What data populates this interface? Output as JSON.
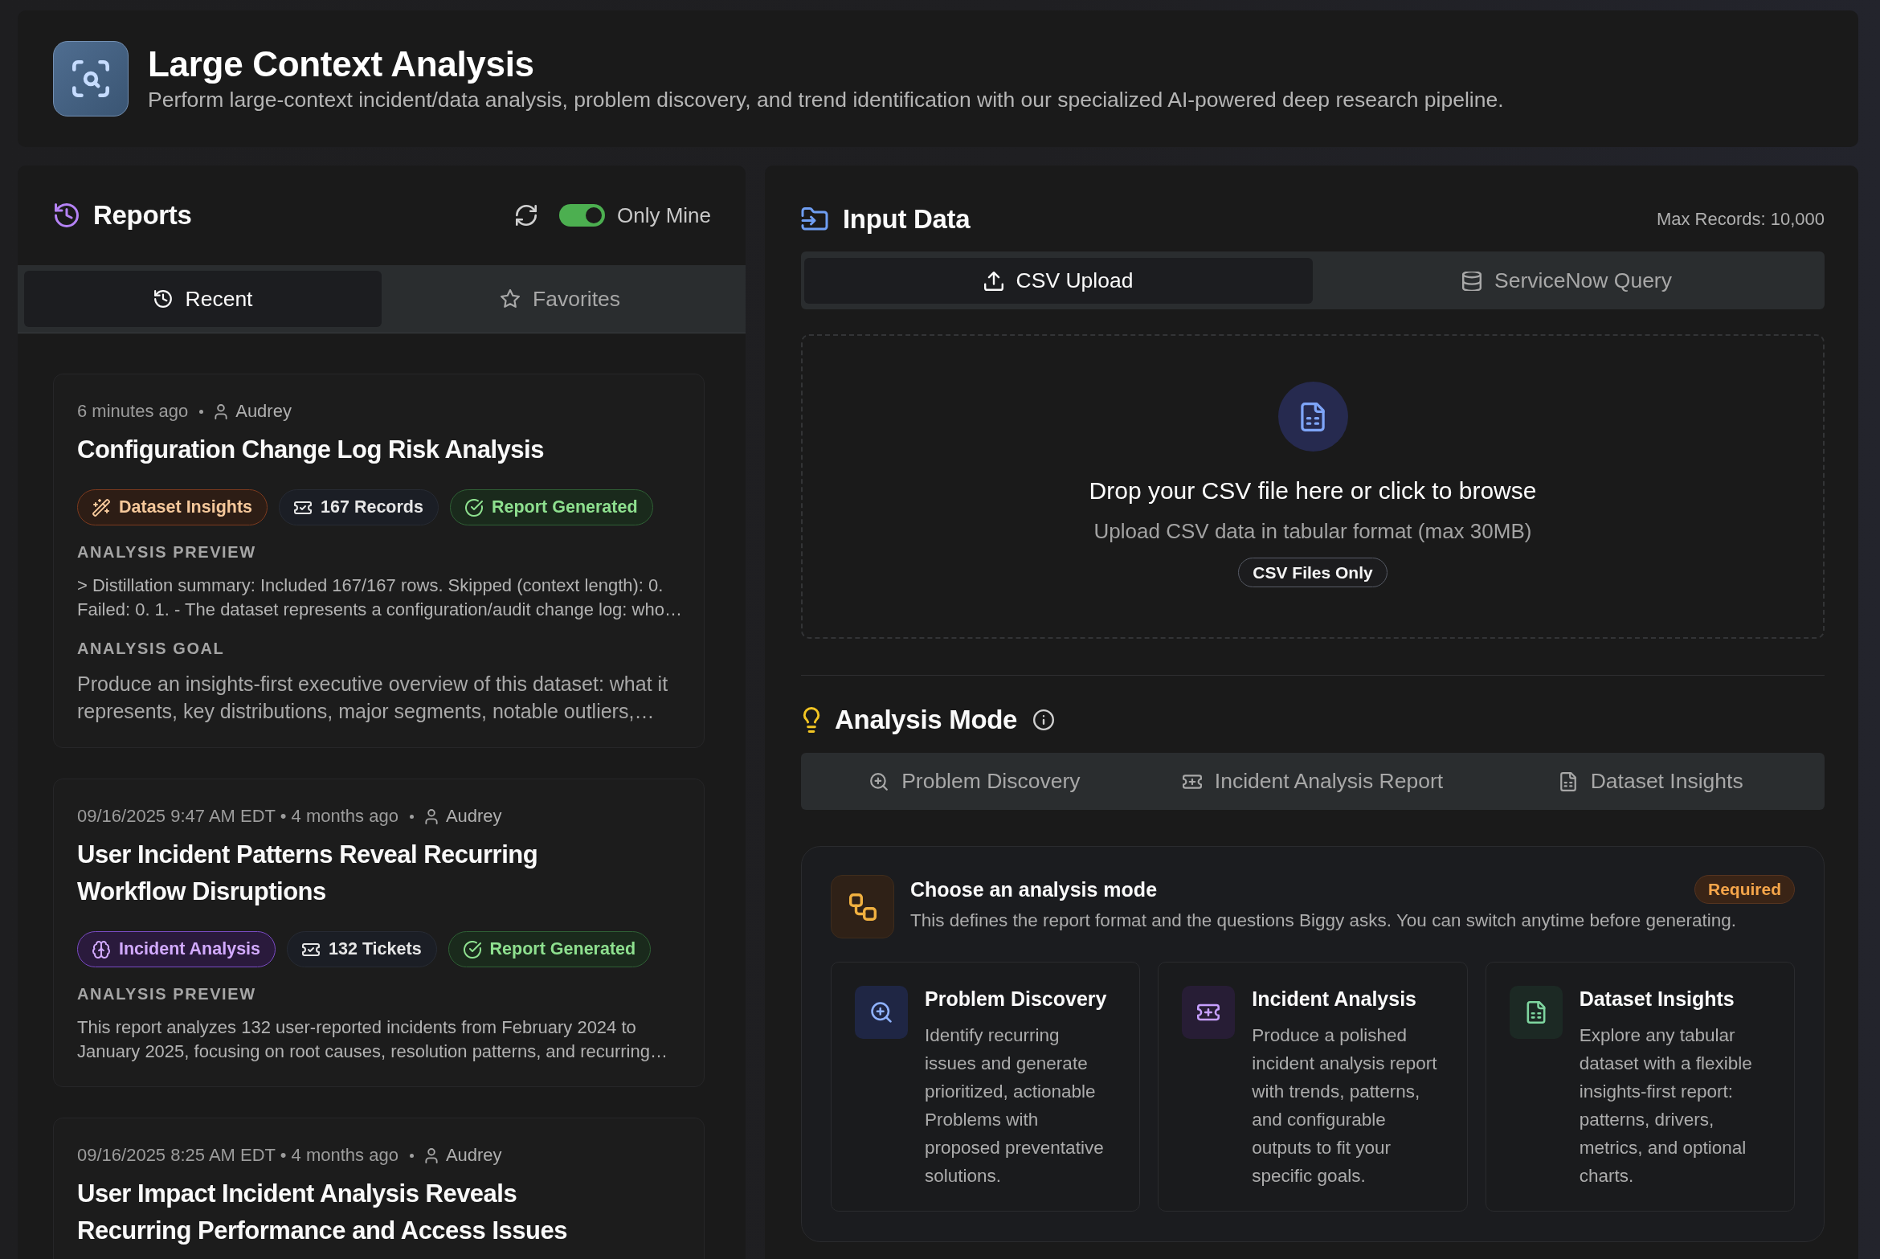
{
  "header": {
    "title": "Large Context Analysis",
    "subtitle": "Perform large-context incident/data analysis, problem discovery, and trend identification with our specialized AI-powered deep research pipeline."
  },
  "reports": {
    "title": "Reports",
    "only_mine": {
      "label": "Only Mine",
      "on": true
    },
    "tabs": [
      {
        "label": "Recent",
        "selected": true
      },
      {
        "label": "Favorites",
        "selected": false
      }
    ],
    "cards": [
      {
        "time": "6 minutes ago",
        "author": "Audrey",
        "title": "Configuration Change Log Risk Analysis",
        "badges": [
          {
            "kind": "insights",
            "label": "Dataset Insights"
          },
          {
            "kind": "count",
            "label": "167 Records"
          },
          {
            "kind": "status",
            "label": "Report Generated"
          }
        ],
        "sections": [
          {
            "kind": "preview",
            "label": "ANALYSIS PREVIEW",
            "text": "> Distillation summary: Included 167/167 rows. Skipped (context length): 0. Failed: 0. 1. - The dataset represents a configuration/audit change log: who…"
          },
          {
            "kind": "goal",
            "label": "ANALYSIS GOAL",
            "text": "Produce an insights-first executive overview of this dataset: what it represents, key distributions, major segments, notable outliers,…"
          }
        ]
      },
      {
        "time": "09/16/2025 9:47 AM EDT • 4 months ago",
        "author": "Audrey",
        "title": "User Incident Patterns Reveal Recurring Workflow Disruptions",
        "badges": [
          {
            "kind": "incident",
            "label": "Incident Analysis"
          },
          {
            "kind": "count",
            "label": "132 Tickets"
          },
          {
            "kind": "status",
            "label": "Report Generated"
          }
        ],
        "sections": [
          {
            "kind": "preview",
            "label": "ANALYSIS PREVIEW",
            "text": "This report analyzes 132 user-reported incidents from February 2024 to January 2025, focusing on root causes, resolution patterns, and recurring…"
          }
        ]
      },
      {
        "time": "09/16/2025 8:25 AM EDT • 4 months ago",
        "author": "Audrey",
        "title": "User Impact Incident Analysis Reveals Recurring Performance and Access Issues"
      }
    ]
  },
  "input": {
    "title": "Input Data",
    "max_records": "Max Records: 10,000",
    "tabs": [
      {
        "label": "CSV Upload",
        "selected": true
      },
      {
        "label": "ServiceNow Query",
        "selected": false
      }
    ],
    "dropzone": {
      "title": "Drop your CSV file here or click to browse",
      "hint": "Upload CSV data in tabular format (max 30MB)",
      "file_type": "CSV Files Only"
    }
  },
  "analysis_mode": {
    "title": "Analysis Mode",
    "tabs": [
      {
        "label": "Problem Discovery",
        "selected": false
      },
      {
        "label": "Incident Analysis Report",
        "selected": false
      },
      {
        "label": "Dataset Insights",
        "selected": false
      }
    ],
    "prompt": {
      "title": "Choose an analysis mode",
      "description": "This defines the report format and the questions Biggy asks. You can switch anytime before generating.",
      "required": "Required"
    },
    "options": [
      {
        "title": "Problem Discovery",
        "description": "Identify recurring issues and generate prioritized, actionable Problems with proposed preventative solutions.",
        "selected": false
      },
      {
        "title": "Incident Analysis",
        "description": "Produce a polished incident analysis report with trends, patterns, and configurable outputs to fit your specific goals.",
        "selected": false
      },
      {
        "title": "Dataset Insights",
        "description": "Explore any tabular dataset with a flexible insights-first report: patterns, drivers, metrics, and optional charts.",
        "selected": false
      }
    ]
  }
}
